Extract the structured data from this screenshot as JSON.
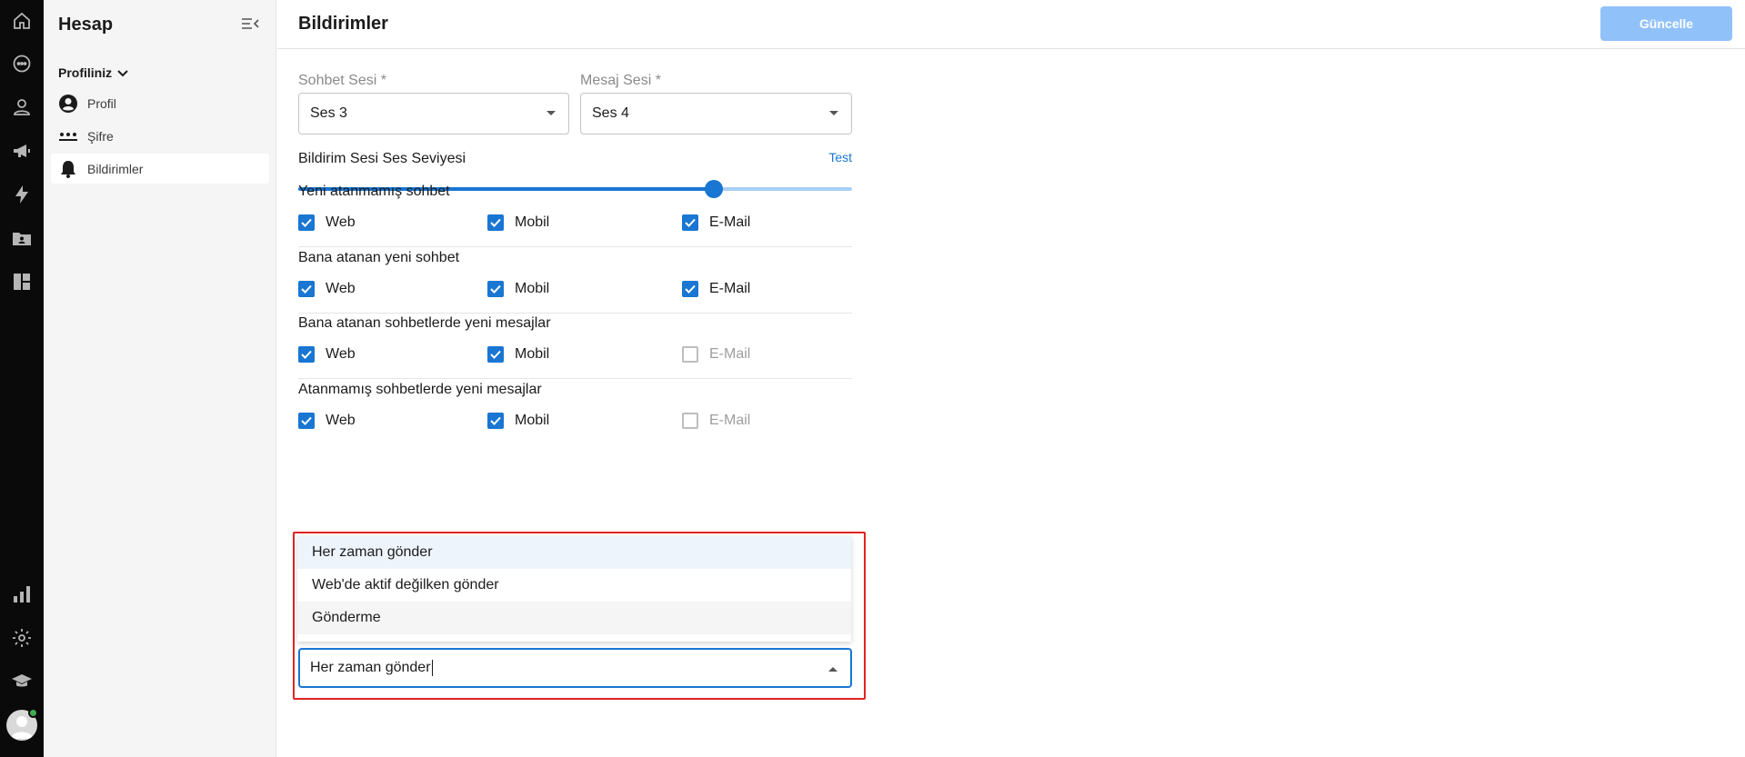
{
  "sidebar": {
    "title": "Hesap",
    "section_label": "Profiliniz",
    "items": [
      {
        "label": "Profil"
      },
      {
        "label": "Şifre"
      },
      {
        "label": "Bildirimler"
      }
    ]
  },
  "header": {
    "title": "Bildirimler",
    "update_label": "Güncelle"
  },
  "form": {
    "chat_sound": {
      "label": "Sohbet Sesi *",
      "value": "Ses 3"
    },
    "message_sound": {
      "label": "Mesaj Sesi *",
      "value": "Ses 4"
    },
    "volume": {
      "label": "Bildirim Sesi Ses Seviyesi",
      "test_label": "Test",
      "level_fraction": 0.75
    },
    "groups": [
      {
        "title": "Yeni atanmamış sohbet",
        "options": [
          {
            "label": "Web",
            "checked": true,
            "disabled": false
          },
          {
            "label": "Mobil",
            "checked": true,
            "disabled": false
          },
          {
            "label": "E-Mail",
            "checked": true,
            "disabled": false
          }
        ]
      },
      {
        "title": "Bana atanan yeni sohbet",
        "options": [
          {
            "label": "Web",
            "checked": true,
            "disabled": false
          },
          {
            "label": "Mobil",
            "checked": true,
            "disabled": false
          },
          {
            "label": "E-Mail",
            "checked": true,
            "disabled": false
          }
        ]
      },
      {
        "title": "Bana atanan sohbetlerde yeni mesajlar",
        "options": [
          {
            "label": "Web",
            "checked": true,
            "disabled": false
          },
          {
            "label": "Mobil",
            "checked": true,
            "disabled": false
          },
          {
            "label": "E-Mail",
            "checked": false,
            "disabled": true
          }
        ]
      },
      {
        "title": "Atanmamış sohbetlerde yeni mesajlar",
        "options": [
          {
            "label": "Web",
            "checked": true,
            "disabled": false
          },
          {
            "label": "Mobil",
            "checked": true,
            "disabled": false
          },
          {
            "label": "E-Mail",
            "checked": false,
            "disabled": true
          }
        ]
      }
    ],
    "send_mode": {
      "value": "Her zaman gönder",
      "options": [
        "Her zaman gönder",
        "Web'de aktif değilken gönder",
        "Gönderme"
      ]
    }
  },
  "colors": {
    "accent": "#1976d2",
    "highlight_border": "#e02424",
    "rail_bg": "#0a0a0a",
    "update_button_bg": "#90c2f9"
  },
  "icons": {
    "rail": [
      "home-icon",
      "chat-icon",
      "contacts-icon",
      "megaphone-icon",
      "bolt-icon",
      "folder-user-icon",
      "dashboard-icon",
      "bar-chart-icon",
      "settings-icon",
      "graduation-cap-icon"
    ],
    "sidebar": [
      "user-circle-icon",
      "password-dots-icon",
      "bell-icon"
    ]
  }
}
